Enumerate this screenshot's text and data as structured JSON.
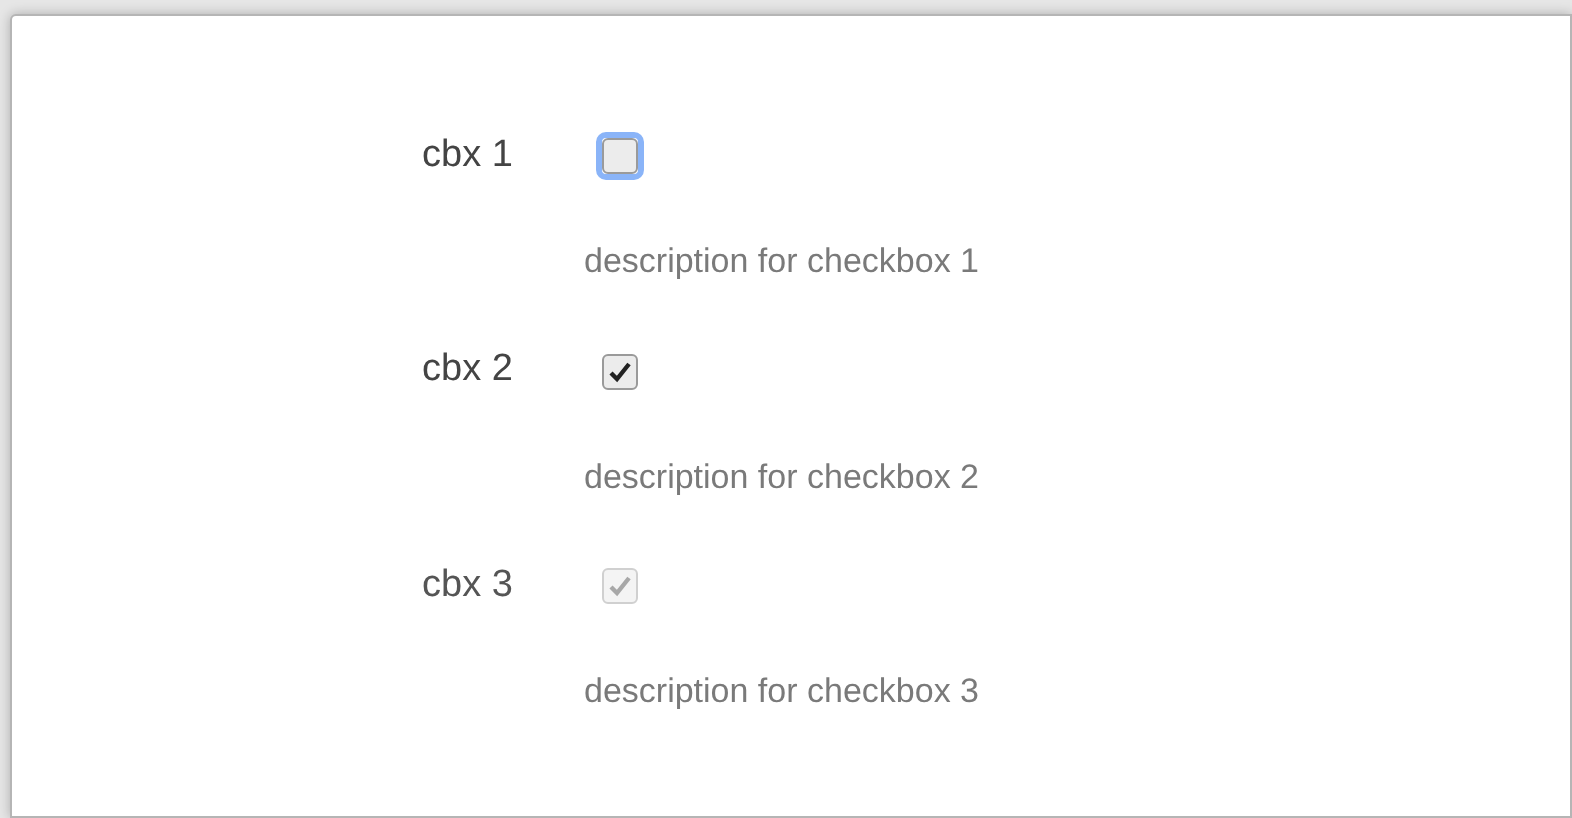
{
  "checkboxes": [
    {
      "label": "cbx 1",
      "checked": false,
      "disabled": false,
      "focused": true,
      "description": "description for checkbox 1"
    },
    {
      "label": "cbx 2",
      "checked": true,
      "disabled": false,
      "focused": false,
      "description": "description for checkbox 2"
    },
    {
      "label": "cbx 3",
      "checked": true,
      "disabled": true,
      "focused": false,
      "description": "description for checkbox 3"
    }
  ]
}
